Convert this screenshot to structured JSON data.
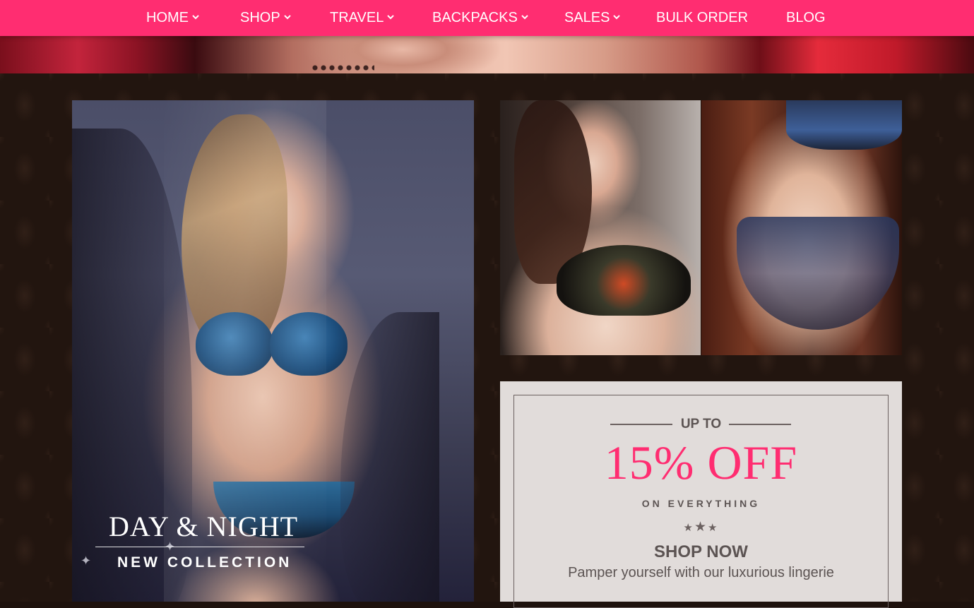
{
  "nav": {
    "items": [
      {
        "label": "HOME",
        "has_dropdown": true
      },
      {
        "label": "SHOP",
        "has_dropdown": true
      },
      {
        "label": "TRAVEL",
        "has_dropdown": true
      },
      {
        "label": "BACKPACKS",
        "has_dropdown": true
      },
      {
        "label": "SALES",
        "has_dropdown": true
      },
      {
        "label": "BULK ORDER",
        "has_dropdown": false
      },
      {
        "label": "BLOG",
        "has_dropdown": false
      }
    ],
    "bg_color": "#ff2d71"
  },
  "feature": {
    "title": "DAY & NIGHT",
    "subtitle": "NEW COLLECTION"
  },
  "promo": {
    "upto": "UP TO",
    "discount": "15% OFF",
    "scope": "ON EVERYTHING",
    "cta": "SHOP NOW",
    "tagline": "Pamper yourself with our luxurious lingerie",
    "accent_color": "#ff2d71"
  },
  "icons": {
    "dropdown": "chevron-down-icon",
    "rating": "star-icon"
  }
}
